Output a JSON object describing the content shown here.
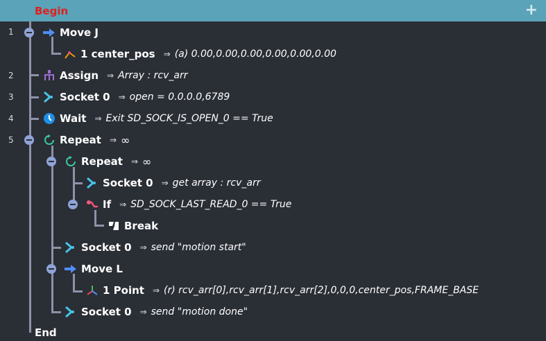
{
  "header": {
    "begin_label": "Begin",
    "add_symbol": "+"
  },
  "footer": {
    "end_label": "End"
  },
  "arrow_symbol": "⇒",
  "line_numbers": [
    "1",
    "2",
    "3",
    "4",
    "5"
  ],
  "colors": {
    "header": "#5aa3b9",
    "begin": "#e0201f",
    "background": "#2a2e35",
    "tree_line": "#8c93a8",
    "move": "#4f8ef5",
    "assign": "#9b6fd6",
    "socket": "#49c4e8",
    "wait": "#1e90e6",
    "repeat": "#3cc7a0",
    "if": "#f0567a"
  },
  "rows": [
    {
      "name": "move-j",
      "icon": "arrow-right-icon",
      "label": "Move J",
      "param": "(a) 0.00,0.00,0.00,0.00,0.00,0.00"
    },
    {
      "name": "center-pos",
      "icon": "joint-pose-icon",
      "label": "1 center_pos",
      "param": "(a) 0.00,0.00,0.00,0.00,0.00,0.00"
    },
    {
      "name": "assign",
      "icon": "assign-icon",
      "label": "Assign",
      "param": "Array : rcv_arr"
    },
    {
      "name": "socket-open",
      "icon": "socket-icon",
      "label": "Socket 0",
      "param": "open = 0.0.0.0,6789"
    },
    {
      "name": "wait",
      "icon": "clock-icon",
      "label": "Wait",
      "param": "Exit SD_SOCK_IS_OPEN_0 == True"
    },
    {
      "name": "repeat-outer",
      "icon": "repeat-icon",
      "label": "Repeat",
      "param": "∞"
    },
    {
      "name": "repeat-inner",
      "icon": "repeat-icon",
      "label": "Repeat",
      "param": "∞"
    },
    {
      "name": "socket-get",
      "icon": "socket-icon",
      "label": "Socket 0",
      "param": "get array : rcv_arr"
    },
    {
      "name": "if",
      "icon": "branch-icon",
      "label": "If",
      "param": "SD_SOCK_LAST_READ_0 == True"
    },
    {
      "name": "break",
      "icon": "break-icon",
      "label": "Break",
      "param": ""
    },
    {
      "name": "socket-send-start",
      "icon": "socket-icon",
      "label": "Socket 0",
      "param": "send \"motion start\""
    },
    {
      "name": "move-l",
      "icon": "arrow-right-icon",
      "label": "Move L",
      "param": ""
    },
    {
      "name": "point",
      "icon": "axis-frame-icon",
      "label": "1 Point",
      "param": "(r) rcv_arr[0],rcv_arr[1],rcv_arr[2],0,0,0,center_pos,FRAME_BASE"
    },
    {
      "name": "socket-send-done",
      "icon": "socket-icon",
      "label": "Socket 0",
      "param": "send \"motion done\""
    }
  ]
}
